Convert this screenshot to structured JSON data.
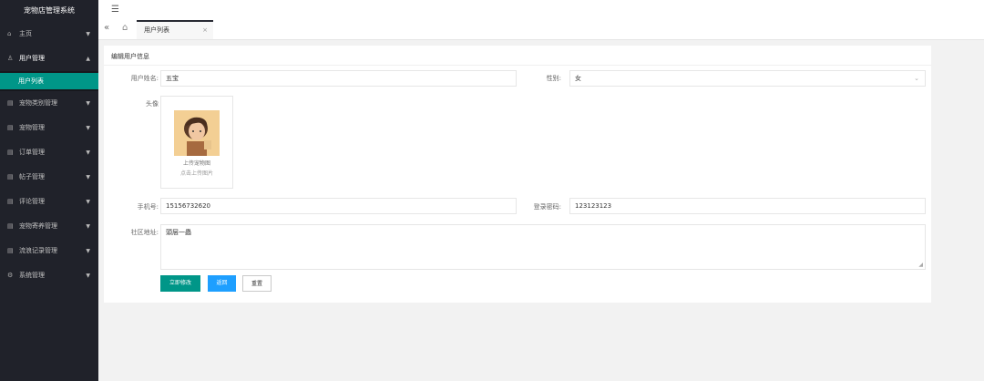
{
  "app": {
    "title": "宠物店管理系统"
  },
  "sidebar": {
    "items": [
      {
        "icon": "home-icon",
        "glyph": "⌂",
        "label": "主页",
        "arrow": "▼"
      },
      {
        "icon": "user-icon",
        "glyph": "♙",
        "label": "用户管理",
        "arrow": "▲"
      },
      {
        "icon": "table-icon",
        "glyph": "▤",
        "label": "宠物类别管理",
        "arrow": "▼"
      },
      {
        "icon": "table-icon",
        "glyph": "▤",
        "label": "宠物管理",
        "arrow": "▼"
      },
      {
        "icon": "table-icon",
        "glyph": "▤",
        "label": "订单管理",
        "arrow": "▼"
      },
      {
        "icon": "table-icon",
        "glyph": "▤",
        "label": "帖子管理",
        "arrow": "▼"
      },
      {
        "icon": "table-icon",
        "glyph": "▤",
        "label": "评论管理",
        "arrow": "▼"
      },
      {
        "icon": "table-icon",
        "glyph": "▤",
        "label": "宠物寄养管理",
        "arrow": "▼"
      },
      {
        "icon": "table-icon",
        "glyph": "▤",
        "label": "流浪记录管理",
        "arrow": "▼"
      },
      {
        "icon": "gear-icon",
        "glyph": "⚙",
        "label": "系统管理",
        "arrow": "▼"
      }
    ],
    "sub_active": "用户列表"
  },
  "topbar": {
    "toggle_glyph": "☰"
  },
  "tabs": {
    "back_glyph": "«",
    "home_glyph": "⌂",
    "active_label": "用户列表",
    "close_glyph": "×"
  },
  "form": {
    "title": "编辑用户信息",
    "username_label": "用户姓名:",
    "username_value": "五宝",
    "gender_label": "性别:",
    "gender_value": "女",
    "avatar_label": "头像",
    "upload_text1": "上传宠物图",
    "upload_text2": "点击上传图片",
    "phone_label": "手机号:",
    "phone_value": "15156732620",
    "password_label": "登录密码:",
    "password_value": "123123123",
    "address_label": "社区地址:",
    "address_value": "頭层一蟲",
    "submit_label": "立即修改",
    "back_label": "返回",
    "reset_label": "重置"
  },
  "colors": {
    "sidebar_bg": "#20222a",
    "accent": "#009688",
    "blue": "#1e9fff"
  }
}
